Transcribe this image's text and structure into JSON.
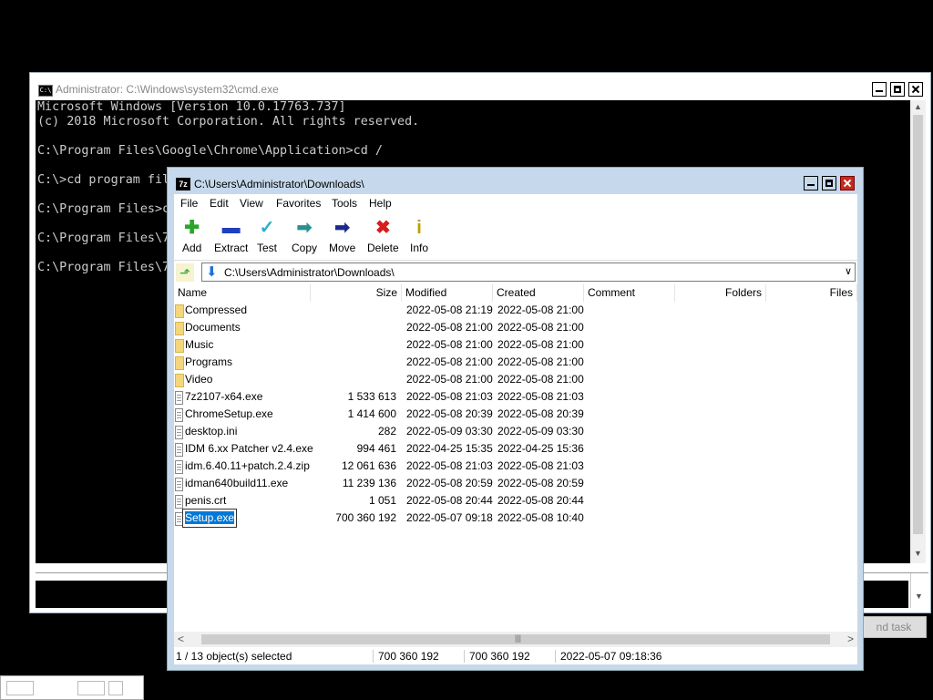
{
  "cmd_window": {
    "title": "Administrator: C:\\Windows\\system32\\cmd.exe",
    "icon_label": "C:\\",
    "console_lines": [
      "Microsoft Windows [Version 10.0.17763.737]",
      "(c) 2018 Microsoft Corporation. All rights reserved.",
      "",
      "C:\\Program Files\\Google\\Chrome\\Application>cd /",
      "",
      "C:\\>cd program fil",
      "",
      "C:\\Program Files>c",
      "",
      "C:\\Program Files\\7",
      "",
      "C:\\Program Files\\7"
    ],
    "end_task_label": "nd task"
  },
  "zip_window": {
    "title": "C:\\Users\\Administrator\\Downloads\\",
    "icon_label": "7z",
    "menu": [
      "File",
      "Edit",
      "View",
      "Favorites",
      "Tools",
      "Help"
    ],
    "toolbar": [
      {
        "label": "Add",
        "icon": "plus-icon",
        "glyph": "✚",
        "color": "#2aa52a"
      },
      {
        "label": "Extract",
        "icon": "minus-icon",
        "glyph": "▬",
        "color": "#1f3fbf"
      },
      {
        "label": "Test",
        "icon": "check-icon",
        "glyph": "✓",
        "color": "#2bb0c8"
      },
      {
        "label": "Copy",
        "icon": "copy-arrow-icon",
        "glyph": "➡",
        "color": "#2a8f8f"
      },
      {
        "label": "Move",
        "icon": "move-arrow-icon",
        "glyph": "➡",
        "color": "#1a2a8c"
      },
      {
        "label": "Delete",
        "icon": "delete-x-icon",
        "glyph": "✖",
        "color": "#d81b1b"
      },
      {
        "label": "Info",
        "icon": "info-icon",
        "glyph": "i",
        "color": "#b8a200"
      }
    ],
    "address": "C:\\Users\\Administrator\\Downloads\\",
    "columns": [
      "Name",
      "Size",
      "Modified",
      "Created",
      "Comment",
      "Folders",
      "Files"
    ],
    "rows": [
      {
        "type": "folder",
        "name": "Compressed",
        "size": "",
        "modified": "2022-05-08 21:19",
        "created": "2022-05-08 21:00"
      },
      {
        "type": "folder",
        "name": "Documents",
        "size": "",
        "modified": "2022-05-08 21:00",
        "created": "2022-05-08 21:00"
      },
      {
        "type": "folder",
        "name": "Music",
        "size": "",
        "modified": "2022-05-08 21:00",
        "created": "2022-05-08 21:00"
      },
      {
        "type": "folder",
        "name": "Programs",
        "size": "",
        "modified": "2022-05-08 21:00",
        "created": "2022-05-08 21:00"
      },
      {
        "type": "folder",
        "name": "Video",
        "size": "",
        "modified": "2022-05-08 21:00",
        "created": "2022-05-08 21:00"
      },
      {
        "type": "file",
        "name": "7z2107-x64.exe",
        "size": "1 533 613",
        "modified": "2022-05-08 21:03",
        "created": "2022-05-08 21:03"
      },
      {
        "type": "file",
        "name": "ChromeSetup.exe",
        "size": "1 414 600",
        "modified": "2022-05-08 20:39",
        "created": "2022-05-08 20:39"
      },
      {
        "type": "file",
        "name": "desktop.ini",
        "size": "282",
        "modified": "2022-05-09 03:30",
        "created": "2022-05-09 03:30"
      },
      {
        "type": "file",
        "name": "IDM 6.xx Patcher v2.4.exe",
        "size": "994 461",
        "modified": "2022-04-25 15:35",
        "created": "2022-04-25 15:36"
      },
      {
        "type": "file",
        "name": "idm.6.40.11+patch.2.4.zip",
        "size": "12 061 636",
        "modified": "2022-05-08 21:03",
        "created": "2022-05-08 21:03"
      },
      {
        "type": "file",
        "name": "idman640build11.exe",
        "size": "11 239 136",
        "modified": "2022-05-08 20:59",
        "created": "2022-05-08 20:59"
      },
      {
        "type": "file",
        "name": "penis.crt",
        "size": "1 051",
        "modified": "2022-05-08 20:44",
        "created": "2022-05-08 20:44"
      },
      {
        "type": "file",
        "name": "Setup.exe",
        "size": "700 360 192",
        "modified": "2022-05-07 09:18",
        "created": "2022-05-08 10:40",
        "selected": true
      }
    ],
    "status": {
      "selection": "1 / 13 object(s) selected",
      "size": "700 360 192",
      "packed": "700 360 192",
      "date": "2022-05-07 09:18:36"
    }
  }
}
